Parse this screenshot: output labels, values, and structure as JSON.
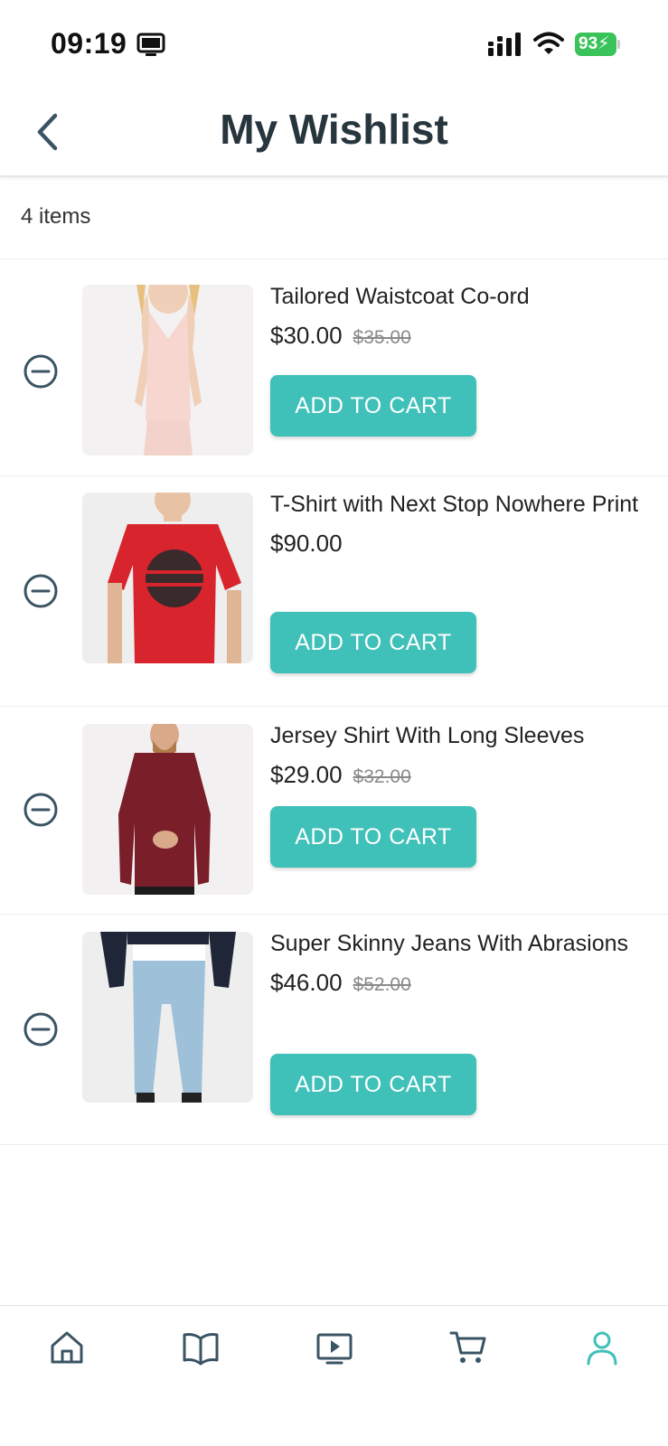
{
  "status_bar": {
    "time": "09:19",
    "battery": "93"
  },
  "header": {
    "title": "My Wishlist"
  },
  "summary": {
    "items_count": "4 items"
  },
  "colors": {
    "accent": "#3fc0b8",
    "title": "#27353d",
    "icon": "#3a5463"
  },
  "wishlist": {
    "items": [
      {
        "name": "Tailored Waistcoat Co-ord",
        "price": "$30.00",
        "old_price": "$35.00",
        "button": "ADD TO CART"
      },
      {
        "name": "T-Shirt with Next Stop Nowhere Print",
        "price": "$90.00",
        "old_price": "",
        "button": "ADD TO CART"
      },
      {
        "name": "Jersey Shirt With Long Sleeves",
        "price": "$29.00",
        "old_price": "$32.00",
        "button": "ADD TO CART"
      },
      {
        "name": "Super Skinny Jeans With Abrasions",
        "price": "$46.00",
        "old_price": "$52.00",
        "button": "ADD TO CART"
      }
    ]
  },
  "bottom_nav": {
    "items": [
      {
        "icon": "home-icon",
        "active": false
      },
      {
        "icon": "book-icon",
        "active": false
      },
      {
        "icon": "video-icon",
        "active": false
      },
      {
        "icon": "cart-icon",
        "active": false
      },
      {
        "icon": "profile-icon",
        "active": true
      }
    ]
  }
}
